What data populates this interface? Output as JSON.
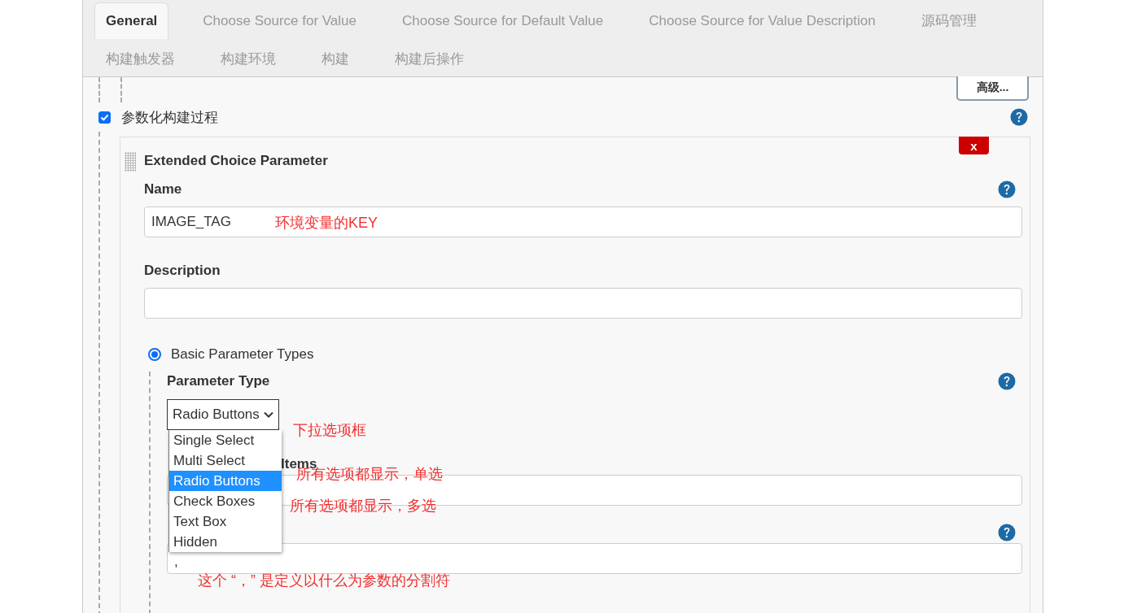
{
  "tab_rows": [
    [
      {
        "label": "General",
        "selected": true
      },
      {
        "label": "Choose Source for Value",
        "selected": false
      },
      {
        "label": "Choose Source for Default Value",
        "selected": false
      },
      {
        "label": "Choose Source for Value Description",
        "selected": false
      },
      {
        "label": "源码管理",
        "selected": false
      }
    ],
    [
      {
        "label": "构建触发器",
        "selected": false
      },
      {
        "label": "构建环境",
        "selected": false
      },
      {
        "label": "构建",
        "selected": false
      },
      {
        "label": "构建后操作",
        "selected": false
      }
    ]
  ],
  "advanced_button": "高级...",
  "parameterized": {
    "label": "参数化构建过程",
    "checked": true
  },
  "parameter": {
    "title": "Extended Choice Parameter",
    "delete_button": "x",
    "name": {
      "label": "Name",
      "value": "IMAGE_TAG"
    },
    "description": {
      "label": "Description"
    },
    "basic_types": {
      "label": "Basic Parameter Types",
      "selected": true
    },
    "parameter_type": {
      "label": "Parameter Type",
      "value": "Radio Buttons",
      "expanded": true,
      "options": [
        {
          "label": "Single Select",
          "selected": false
        },
        {
          "label": "Multi Select",
          "selected": false
        },
        {
          "label": "Radio Buttons",
          "selected": true
        },
        {
          "label": "Check Boxes",
          "selected": false
        },
        {
          "label": "Text Box",
          "selected": false
        },
        {
          "label": "Hidden",
          "selected": false
        }
      ]
    },
    "value_items": {
      "label": "Items"
    },
    "delimiter": {
      "value": ","
    }
  },
  "annotations": [
    {
      "text": "环境变量的KEY"
    },
    {
      "text": "下拉选项框"
    },
    {
      "text": "所有选项都显示，单选"
    },
    {
      "text": "所有选项都显示，多选"
    },
    {
      "text": "这个 “，” 是定义以什么为参数的分割符"
    }
  ]
}
